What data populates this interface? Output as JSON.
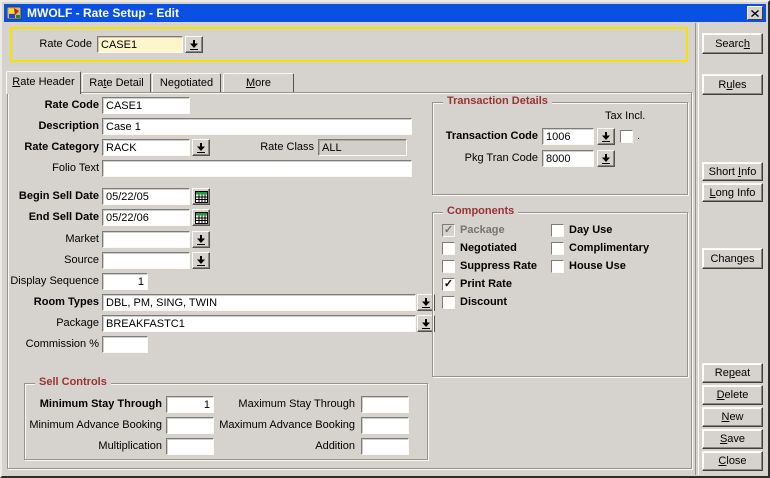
{
  "window": {
    "title": "MWOLF - Rate Setup - Edit"
  },
  "icons": {
    "app_icon": "app-logo",
    "close_glyph": "✕",
    "lov_glyph": "down-arrow-underline",
    "calendar_glyph": "calendar-grid",
    "check_glyph": "✓"
  },
  "colors": {
    "titlebar_blue": "#0a50e2",
    "dialog_bg": "#d6d3ce",
    "group_title_maroon": "#993333",
    "query_highlight_yellow": "#f5e400",
    "query_input_cream": "#fdf6cd"
  },
  "query_bar": {
    "label": "Rate Code",
    "value": "CASE1"
  },
  "tabs": [
    {
      "pre": "",
      "u": "R",
      "post": "ate Header",
      "active": true
    },
    {
      "pre": "Ra",
      "u": "t",
      "post": "e Detail",
      "active": false
    },
    {
      "pre": "Negotiated",
      "u": "",
      "post": "",
      "active": false
    },
    {
      "pre": "",
      "u": "M",
      "post": "ore",
      "active": false
    }
  ],
  "form": {
    "rate_code": {
      "label": "Rate Code",
      "value": "CASE1"
    },
    "description": {
      "label": "Description",
      "value": "Case 1"
    },
    "rate_category": {
      "label": "Rate Category",
      "value": "RACK"
    },
    "rate_class": {
      "label": "Rate Class",
      "value": "ALL"
    },
    "folio_text": {
      "label": "Folio Text",
      "value": ""
    },
    "begin_sell_date": {
      "label": "Begin Sell Date",
      "value": "05/22/05"
    },
    "end_sell_date": {
      "label": "End Sell Date",
      "value": "05/22/06"
    },
    "market": {
      "label": "Market",
      "value": ""
    },
    "source": {
      "label": "Source",
      "value": ""
    },
    "display_sequence": {
      "label": "Display Sequence",
      "value": "1"
    },
    "room_types": {
      "label": "Room Types",
      "value": "DBL, PM, SING, TWIN"
    },
    "package": {
      "label": "Package",
      "value": "BREAKFASTC1"
    },
    "commission_pct": {
      "label": "Commission %",
      "value": ""
    }
  },
  "transaction_details": {
    "title": "Transaction Details",
    "tax_incl_label": "Tax Incl.",
    "tax_incl_checked": false,
    "tax_incl_suffix": ".",
    "transaction_code": {
      "label": "Transaction Code",
      "value": "1006"
    },
    "pkg_tran_code": {
      "label": "Pkg Tran Code",
      "value": "8000"
    }
  },
  "components": {
    "title": "Components",
    "items": [
      {
        "label": "Package",
        "checked": true,
        "disabled": true
      },
      {
        "label": "Negotiated",
        "checked": false,
        "disabled": false
      },
      {
        "label": "Suppress Rate",
        "checked": false,
        "disabled": false
      },
      {
        "label": "Print Rate",
        "checked": true,
        "disabled": false
      },
      {
        "label": "Discount",
        "checked": false,
        "disabled": false
      },
      {
        "label": "Day Use",
        "checked": false,
        "disabled": false
      },
      {
        "label": "Complimentary",
        "checked": false,
        "disabled": false
      },
      {
        "label": "House Use",
        "checked": false,
        "disabled": false
      }
    ]
  },
  "sell_controls": {
    "title": "Sell Controls",
    "fields": [
      {
        "label": "Minimum Stay Through",
        "value": "1"
      },
      {
        "label": "Maximum Stay Through",
        "value": ""
      },
      {
        "label": "Minimum Advance Booking",
        "value": ""
      },
      {
        "label": "Maximum Advance Booking",
        "value": ""
      },
      {
        "label": "Multiplication",
        "value": ""
      },
      {
        "label": "Addition",
        "value": ""
      }
    ]
  },
  "side_buttons": [
    {
      "pre": "Searc",
      "u": "h",
      "post": ""
    },
    {
      "pre": "R",
      "u": "u",
      "post": "les"
    },
    {
      "pre": "Short ",
      "u": "I",
      "post": "nfo"
    },
    {
      "pre": "",
      "u": "L",
      "post": "ong Info"
    },
    {
      "pre": "Chan",
      "u": "g",
      "post": "es"
    },
    {
      "pre": "Re",
      "u": "p",
      "post": "eat"
    },
    {
      "pre": "",
      "u": "D",
      "post": "elete"
    },
    {
      "pre": "",
      "u": "N",
      "post": "ew"
    },
    {
      "pre": "",
      "u": "S",
      "post": "ave"
    },
    {
      "pre": "",
      "u": "C",
      "post": "lose"
    }
  ]
}
